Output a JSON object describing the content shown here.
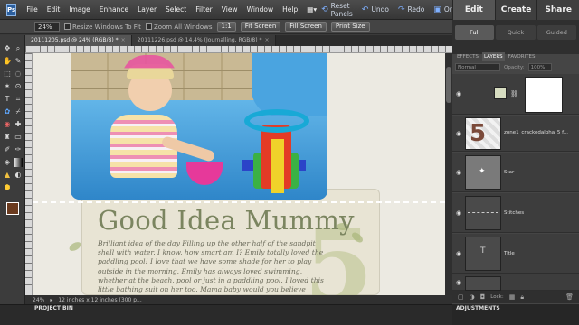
{
  "app": {
    "logo": "Ps"
  },
  "menu": [
    "File",
    "Edit",
    "Image",
    "Enhance",
    "Layer",
    "Select",
    "Filter",
    "View",
    "Window",
    "Help"
  ],
  "toolbar": {
    "reset_panels": "Reset Panels",
    "undo": "Undo",
    "redo": "Redo",
    "organizer": "Organizer"
  },
  "modes": {
    "tabs": [
      "Edit",
      "Create",
      "Share"
    ],
    "active": "Edit",
    "subtabs": [
      "Full",
      "Quick",
      "Guided"
    ],
    "active_sub": "Full"
  },
  "options": {
    "zoom": "24%",
    "resize_windows": "Resize Windows To Fit",
    "zoom_all": "Zoom All Windows",
    "btn_1to1": "1:1",
    "fit_screen": "Fit Screen",
    "fill_screen": "Fill Screen",
    "print_size": "Print Size"
  },
  "documents": [
    {
      "name": "20111205.psd @ 24% (RGB/8) *"
    },
    {
      "name": "20111226.psd @ 14.4% (Journalling, RGB/8) *"
    }
  ],
  "canvas": {
    "title": "Good Idea Mummy",
    "journal": "Brilliant idea of the day Filling up the other half of the sandpit shell with water. I know, how smart am I? Emily totally loved the paddling pool! I love that we have some shade for her to play outside in the morning. Emily has always loved swimming, whether at the beach, pool or just in a paddling pool. I loved this little bathing suit on her too. Mama baby would you believe",
    "big_number": "5"
  },
  "status": {
    "zoom": "24%",
    "doc_size": "12 inches x 12 inches (300 p..."
  },
  "project_bin": "PROJECT BIN",
  "panel": {
    "tabs": [
      "EFFECTS",
      "LAYERS",
      "FAVORITES"
    ],
    "active_tab": "LAYERS",
    "blend_mode": "Normal",
    "opacity_label": "Opacity:",
    "opacity_value": "100%",
    "lock_label": "Lock:",
    "layers": [
      {
        "name": ""
      },
      {
        "name": "zone1_crackedalpha_5 f..."
      },
      {
        "name": "Star"
      },
      {
        "name": "Stitches"
      },
      {
        "name": "Title"
      },
      {
        "name": ""
      }
    ],
    "adjustments": "ADJUSTMENTS"
  }
}
